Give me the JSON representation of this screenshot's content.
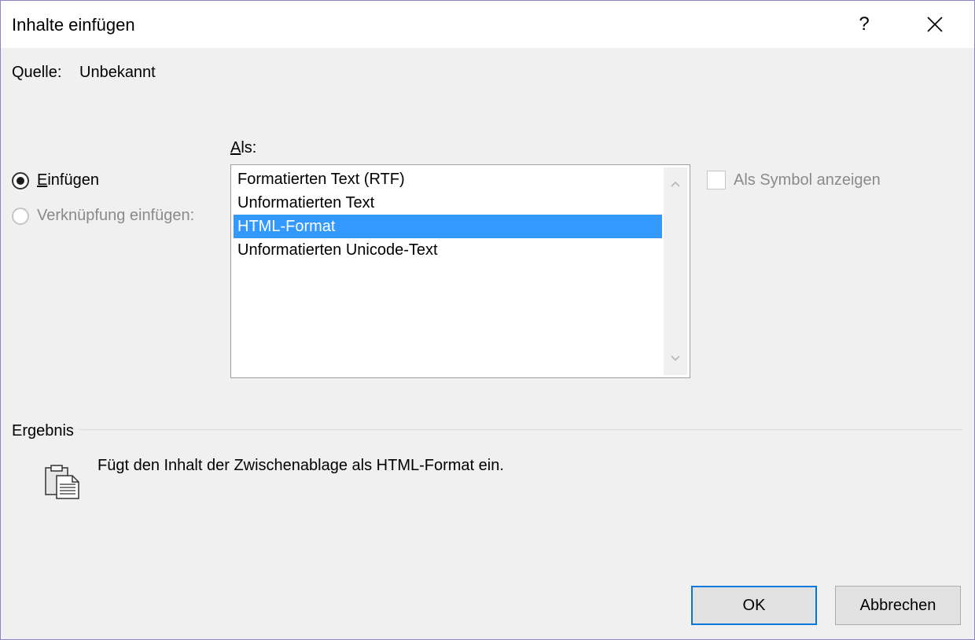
{
  "dialog": {
    "title": "Inhalte einfügen",
    "help_label": "?"
  },
  "source": {
    "label": "Quelle:",
    "value": "Unbekannt"
  },
  "paste_options": {
    "paste_first": "E",
    "paste_rest": "infügen",
    "paste_checked": true,
    "link_label": "Verknüpfung einfügen:",
    "link_enabled": false
  },
  "format_list": {
    "label_first": "A",
    "label_rest": "ls:",
    "items": [
      "Formatierten Text (RTF)",
      "Unformatierten Text",
      "HTML-Format",
      "Unformatierten Unicode-Text"
    ],
    "selected": "HTML-Format"
  },
  "symbol_option": {
    "label": "Als Symbol anzeigen",
    "checked": false,
    "enabled": false
  },
  "result": {
    "label": "Ergebnis",
    "description": "Fügt den Inhalt der Zwischenablage als HTML-Format ein.",
    "icon": "clipboard-document-icon"
  },
  "buttons": {
    "ok": "OK",
    "cancel": "Abbrechen"
  },
  "colors": {
    "selection": "#3399ff",
    "dialog_border": "#8d84c8",
    "default_button_border": "#0078d7"
  }
}
